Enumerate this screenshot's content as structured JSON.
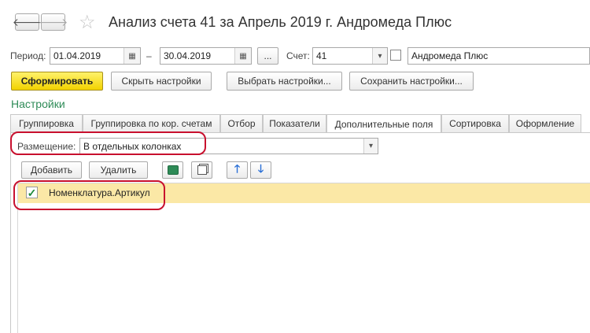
{
  "window": {
    "title": "Анализ счета 41 за Апрель 2019 г. Андромеда Плюс",
    "back_label": "🡐",
    "forward_label": "🡒",
    "star_label": "☆"
  },
  "period": {
    "label": "Период:",
    "from": "01.04.2019",
    "dash": "–",
    "to": "30.04.2019",
    "dots_label": "..."
  },
  "account": {
    "label": "Счет:",
    "value": "41",
    "organization": "Андромеда Плюс"
  },
  "toolbar": {
    "generate": "Сформировать",
    "hide_settings": "Скрыть настройки",
    "choose_settings": "Выбрать настройки...",
    "save_settings": "Сохранить настройки..."
  },
  "settings": {
    "heading": "Настройки",
    "tabs": [
      {
        "label": "Группировка"
      },
      {
        "label": "Группировка по кор. счетам"
      },
      {
        "label": "Отбор"
      },
      {
        "label": "Показатели"
      },
      {
        "label": "Дополнительные поля"
      },
      {
        "label": "Сортировка"
      },
      {
        "label": "Оформление"
      }
    ],
    "active_tab": "Дополнительные поля"
  },
  "placement": {
    "label": "Размещение:",
    "value": "В отдельных колонках"
  },
  "list_toolbar": {
    "add": "Добавить",
    "delete": "Удалить"
  },
  "fields": [
    {
      "label": "Номенклатура.Артикул",
      "checked": true
    }
  ],
  "colors": {
    "accent_green": "#2e8b57",
    "selection_row": "#fbe8a6",
    "highlight_red": "#c8102e",
    "primary_button": "#f2d200"
  }
}
